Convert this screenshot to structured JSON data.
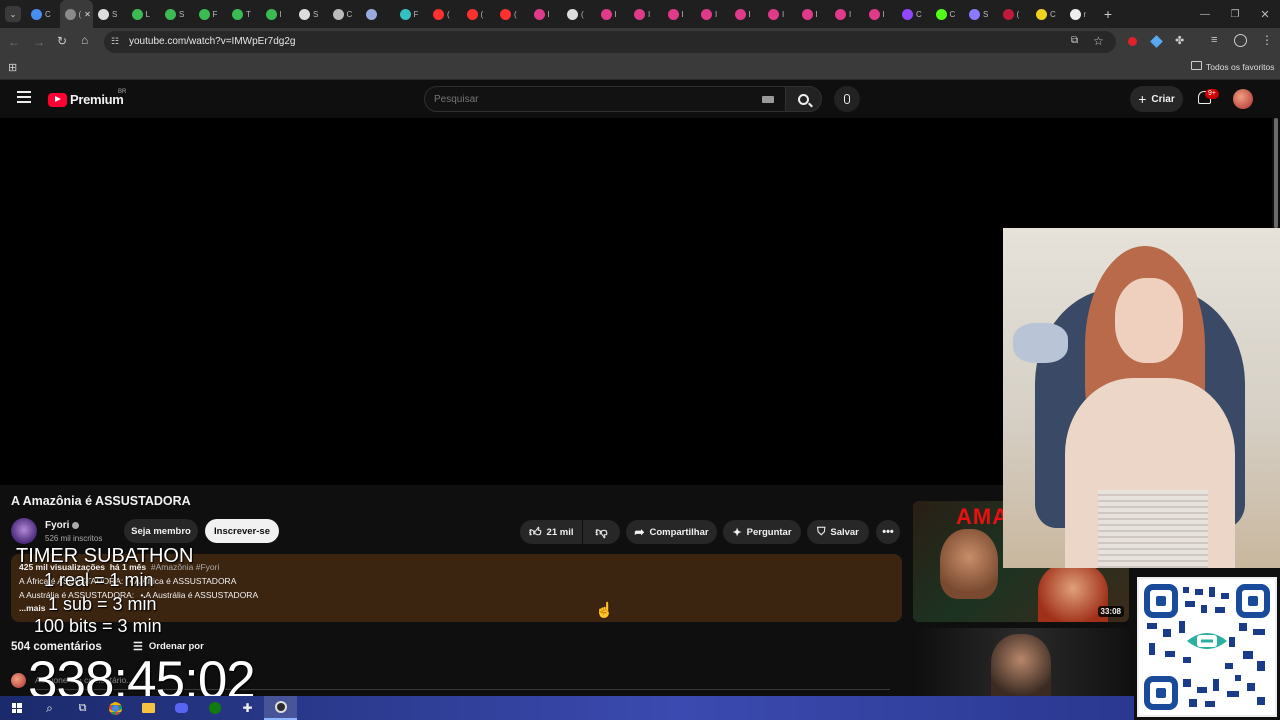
{
  "browser": {
    "url": "youtube.com/watch?v=IMWpEr7dg2g",
    "bookmarks_folder": "Todos os favoritos",
    "tab_letters": [
      "C",
      "(",
      "S",
      "L",
      "S",
      "F",
      "T",
      "I",
      "S",
      "C",
      "",
      "F",
      "(",
      "(",
      "(",
      "I",
      "(",
      "I",
      "I",
      "I",
      "I",
      "I",
      "I",
      "I",
      "I",
      "I",
      "C",
      "C",
      "S",
      "(",
      "C",
      "r"
    ]
  },
  "youtube": {
    "logo_text": "Premium",
    "country": "BR",
    "search_placeholder": "Pesquisar",
    "create_label": "Criar",
    "notifications_badge": "9+"
  },
  "video": {
    "title": "A Amazônia é ASSUSTADORA",
    "channel_name": "Fyori",
    "subscribers": "526 mil inscritos",
    "member_button": "Seja membro",
    "subscribe_button": "Inscrever-se",
    "likes": "21 mil",
    "share_label": "Compartilhar",
    "ask_label": "Perguntar",
    "save_label": "Salvar",
    "views": "425 mil visualizações",
    "age": "há 1 mês",
    "hashtags": "#Amazônia #Fyori",
    "desc_line1": "A África é ASSUSTADORA:",
    "desc_link1": "• A África é ASSUSTADORA",
    "desc_line2": "A Austrália é ASSUSTADORA:",
    "desc_link2": "• A Austrália é ASSUSTADORA",
    "more": "...mais",
    "comments_count": "504 comentários",
    "sort_label": "Ordenar por",
    "comment_placeholder": "Adicione um comentário..."
  },
  "recommendations": [
    {
      "duration": "33:08",
      "thumb_text": "AMA"
    },
    {
      "duration": ""
    }
  ],
  "overlay": {
    "heading": "TIMER SUBATHON",
    "line1": "1 real = 1 min",
    "line2": "1 sub = 3 min",
    "line3": "100 bits = 3 min",
    "timer": "338:45:02"
  }
}
